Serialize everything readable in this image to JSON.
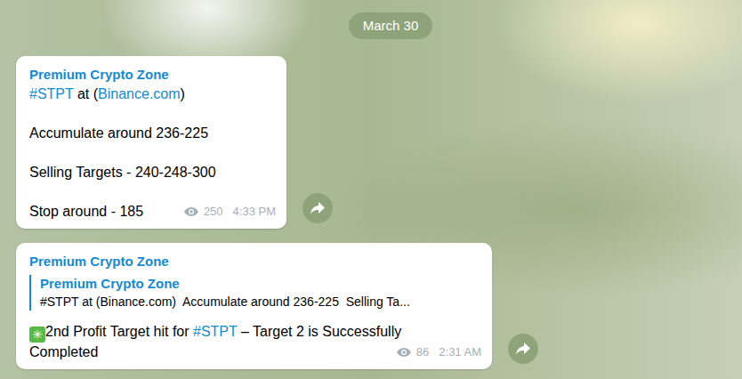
{
  "date": "March 30",
  "messages": [
    {
      "sender": "Premium Crypto Zone",
      "reply": null,
      "lines": [
        [
          {
            "text": "#STPT",
            "kind": "link"
          },
          {
            "text": " at (",
            "kind": "plain"
          },
          {
            "text": "Binance.com",
            "kind": "link"
          },
          {
            "text": ")",
            "kind": "plain"
          }
        ],
        [],
        [
          {
            "text": "Accumulate around 236-225",
            "kind": "plain"
          }
        ],
        [],
        [
          {
            "text": "Selling Targets - 240-248-300",
            "kind": "plain"
          }
        ],
        [],
        [
          {
            "text": "Stop around - 185",
            "kind": "plain"
          }
        ]
      ],
      "views": "250",
      "time": "4:33 PM"
    },
    {
      "sender": "Premium Crypto Zone",
      "reply": {
        "sender": "Premium Crypto Zone",
        "text": "#STPT at (Binance.com)  Accumulate around 236-225  Selling Ta..."
      },
      "lines": [
        [
          {
            "text": "✳",
            "kind": "emoji"
          },
          {
            "text": "2nd Profit Target hit for ",
            "kind": "plain"
          },
          {
            "text": "#STPT",
            "kind": "link"
          },
          {
            "text": " – Target 2 is Successfully",
            "kind": "plain"
          }
        ],
        [
          {
            "text": "Completed",
            "kind": "plain"
          }
        ]
      ],
      "views": "86",
      "time": "2:31 AM"
    }
  ]
}
